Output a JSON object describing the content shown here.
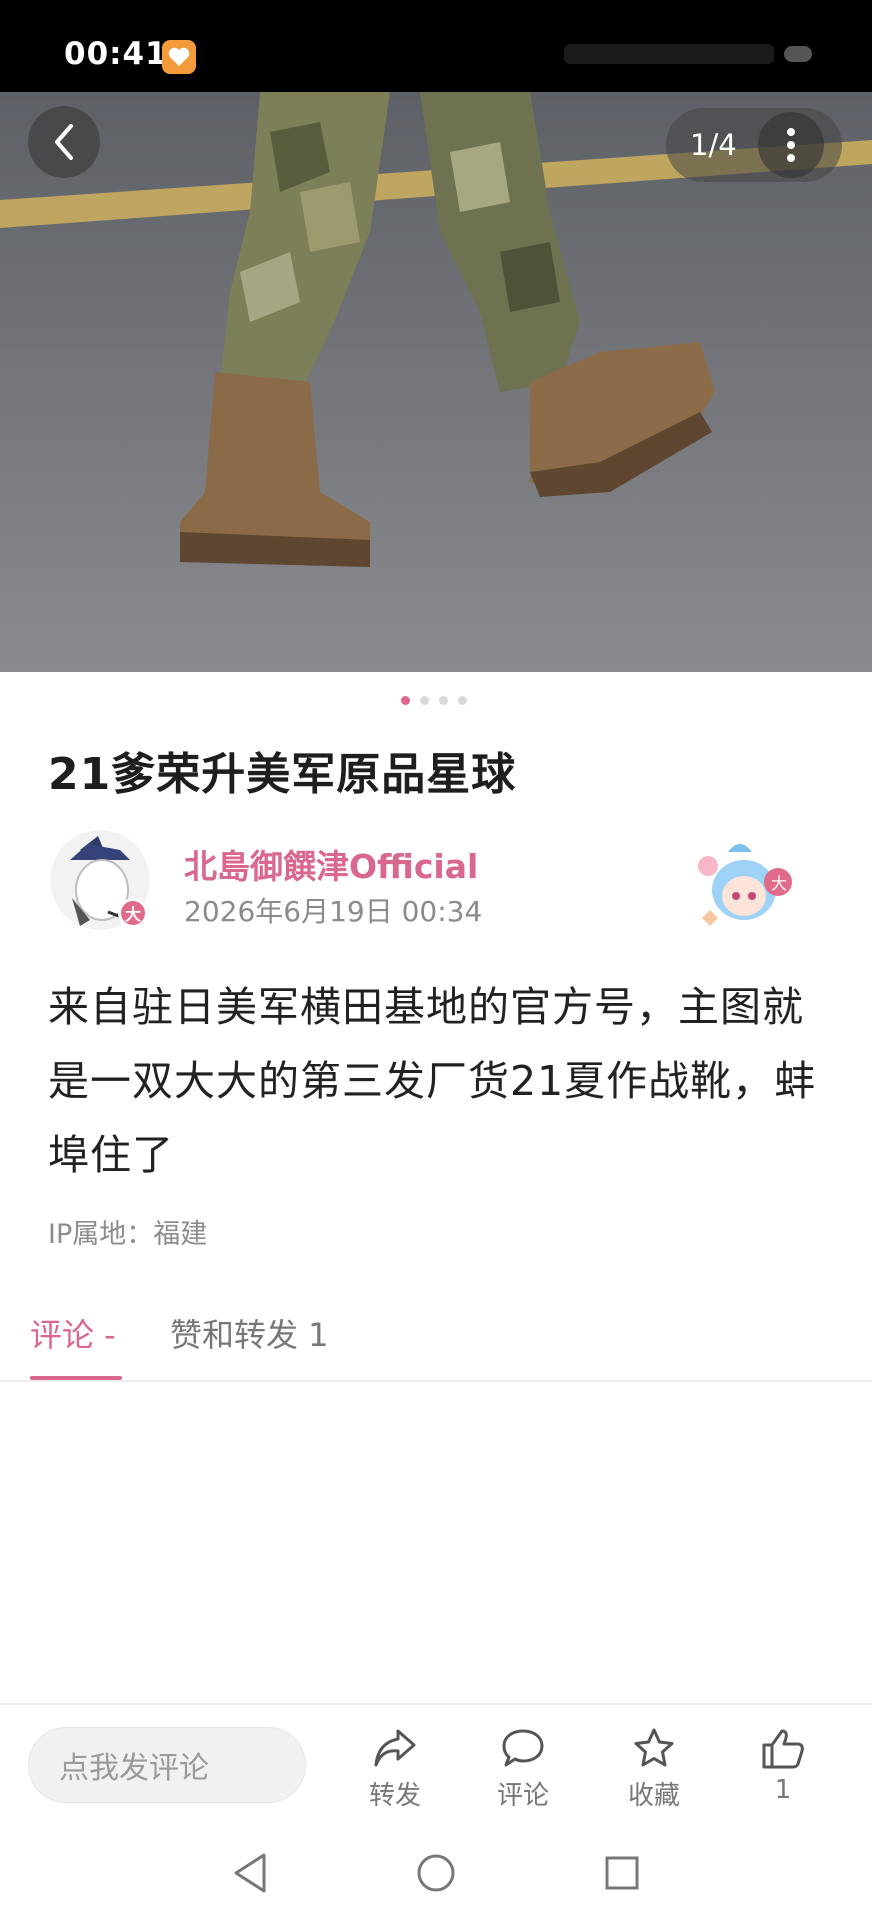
{
  "status_bar": {
    "time": "00:41",
    "app_icon": "heart-app-icon"
  },
  "gallery": {
    "counter": "1/4",
    "total_dots": 4,
    "active_dot": 0
  },
  "post": {
    "title": "21爹荣升美军原品星球",
    "author": "北島御饌津Official",
    "date": "2026年6月19日 00:34",
    "avatar_badge": "大",
    "body": "来自驻日美军横田基地的官方号，主图就是一双大大的第三发厂货21夏作战靴，蚌埠住了",
    "ip_location": "IP属地：福建"
  },
  "tabs": [
    {
      "label": "评论 -",
      "active": true
    },
    {
      "label": "赞和转发 1",
      "active": false
    }
  ],
  "action_bar": {
    "comment_placeholder": "点我发评论",
    "repost_label": "转发",
    "comment_label": "评论",
    "favorite_label": "收藏",
    "like_count": "1"
  },
  "colors": {
    "accent": "#d9678e",
    "text": "#222222",
    "muted": "#8b8b8b"
  }
}
